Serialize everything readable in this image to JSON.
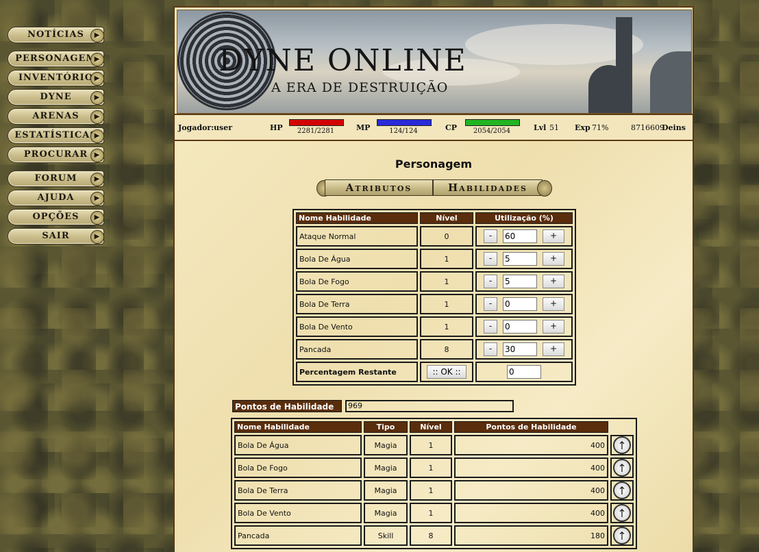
{
  "menu": {
    "items": [
      {
        "label": "Notícias"
      },
      {
        "label": "Personagem"
      },
      {
        "label": "Inventório"
      },
      {
        "label": "Dyne"
      },
      {
        "label": "Arenas"
      },
      {
        "label": "Estatísticas"
      },
      {
        "label": "Procurar"
      },
      {
        "label": "Forum"
      },
      {
        "label": "Ajuda"
      },
      {
        "label": "Opções"
      },
      {
        "label": "Sair"
      }
    ]
  },
  "banner": {
    "title": "DYNE ONLINE",
    "subtitle": "A ERA DE DESTRUIÇÃO"
  },
  "status": {
    "player_label": "Jogador:",
    "player_name": "user",
    "hp_label": "HP",
    "hp_value": "2281/2281",
    "hp_fraction": 1.0,
    "hp_color": "#d40000",
    "mp_label": "MP",
    "mp_value": "124/124",
    "mp_fraction": 1.0,
    "mp_color": "#2a2ad8",
    "cp_label": "CP",
    "cp_value": "2054/2054",
    "cp_fraction": 1.0,
    "cp_color": "#22b422",
    "lvl_label": "Lvl",
    "lvl_value": "51",
    "exp_label": "Exp",
    "exp_value": "71%",
    "deins_value": "8716609",
    "deins_label": "Deins"
  },
  "page": {
    "title": "Personagem",
    "tabs": [
      {
        "label": "Atributos"
      },
      {
        "label": "Habilidades"
      }
    ]
  },
  "usage_table": {
    "headers": [
      "Nome Habilidade",
      "Nível",
      "Utilização (%)"
    ],
    "rows": [
      {
        "name": "Ataque Normal",
        "level": "0",
        "usage": "60"
      },
      {
        "name": "Bola De Água",
        "level": "1",
        "usage": "5"
      },
      {
        "name": "Bola De Fogo",
        "level": "1",
        "usage": "5"
      },
      {
        "name": "Bola De Terra",
        "level": "1",
        "usage": "0"
      },
      {
        "name": "Bola De Vento",
        "level": "1",
        "usage": "0"
      },
      {
        "name": "Pancada",
        "level": "8",
        "usage": "30"
      }
    ],
    "minus_label": "-",
    "plus_label": "+",
    "remaining_label": "Percentagem Restante",
    "ok_label": ":: OK ::",
    "remaining_value": "0"
  },
  "skill_points": {
    "label": "Pontos de Habilidade",
    "value": "969"
  },
  "skills_table": {
    "headers": [
      "Nome Habilidade",
      "Tipo",
      "Nível",
      "Pontos de Habilidade"
    ],
    "rows": [
      {
        "name": "Bola De Água",
        "type": "Magia",
        "level": "1",
        "points": "400"
      },
      {
        "name": "Bola De Fogo",
        "type": "Magia",
        "level": "1",
        "points": "400"
      },
      {
        "name": "Bola De Terra",
        "type": "Magia",
        "level": "1",
        "points": "400"
      },
      {
        "name": "Bola De Vento",
        "type": "Magia",
        "level": "1",
        "points": "400"
      },
      {
        "name": "Pancada",
        "type": "Skill",
        "level": "8",
        "points": "180"
      }
    ]
  }
}
